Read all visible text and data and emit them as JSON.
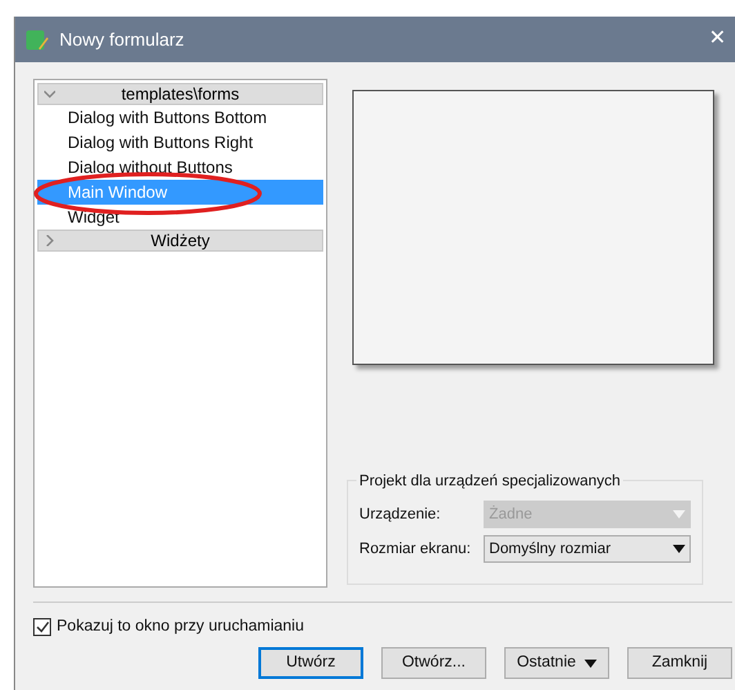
{
  "window": {
    "title": "Nowy formularz",
    "close": "✕"
  },
  "tree": [
    {
      "label": "templates\\forms",
      "expanded": true,
      "children": [
        {
          "label": "Dialog with Buttons Bottom",
          "selected": false
        },
        {
          "label": "Dialog with Buttons Right",
          "selected": false
        },
        {
          "label": "Dialog without Buttons",
          "selected": false
        },
        {
          "label": "Main Window",
          "selected": true
        },
        {
          "label": "Widget",
          "selected": false
        }
      ]
    },
    {
      "label": "Widżety",
      "expanded": false
    }
  ],
  "device_group": {
    "title": "Projekt dla urządzeń specjalizowanych",
    "fields": [
      {
        "label": "Urządzenie:",
        "value": "Żadne",
        "disabled": true
      },
      {
        "label": "Rozmiar ekranu:",
        "value": "Domyślny rozmiar",
        "disabled": false
      }
    ]
  },
  "show_on_startup": {
    "label": "Pokazuj to okno przy uruchamianiu",
    "checked": true
  },
  "buttons": [
    {
      "label": "Utwórz",
      "kind": "default"
    },
    {
      "label": "Otwórz...",
      "kind": "plain"
    },
    {
      "label": "Ostatnie",
      "kind": "menu"
    },
    {
      "label": "Zamknij",
      "kind": "plain"
    }
  ]
}
